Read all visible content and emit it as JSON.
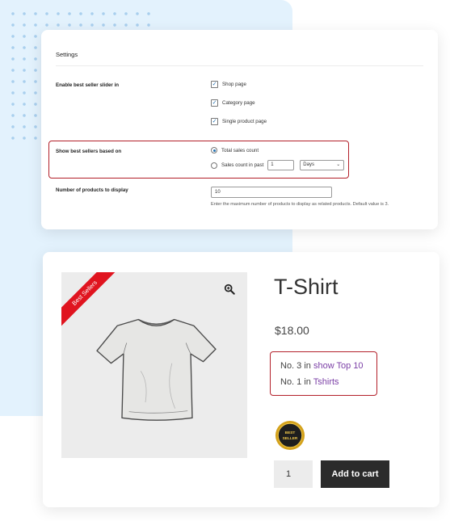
{
  "settings": {
    "title": "Settings",
    "enable_slider_label": "Enable best seller slider in",
    "slider_options": [
      {
        "label": "Shop page",
        "checked": true
      },
      {
        "label": "Category page",
        "checked": true
      },
      {
        "label": "Single product page",
        "checked": true
      }
    ],
    "based_on_label": "Show best sellers based on",
    "based_on_options": [
      {
        "label": "Total sales count",
        "selected": true
      },
      {
        "label": "Sales count in past",
        "selected": false
      }
    ],
    "past_value": "1",
    "past_unit": "Days",
    "num_products_label": "Number of products to display",
    "num_products_value": "10",
    "help_text": "Enter the maximum number of products to display as related products. Default value is 3."
  },
  "product": {
    "ribbon": "Best Sellers",
    "title": "T-Shirt",
    "price": "$18.00",
    "rank1_prefix": "No. 3",
    "rank1_in": "in",
    "rank1_link": "show Top 10",
    "rank2_prefix": "No. 1",
    "rank2_in": "in",
    "rank2_link": "Tshirts",
    "seal_line1": "BEST",
    "seal_line2": "SELLER",
    "quantity": "1",
    "add_to_cart": "Add to cart"
  },
  "colors": {
    "highlight_border": "#b3202a",
    "ribbon": "#e0141f",
    "link": "#7b3fa6",
    "button": "#2b2b2b",
    "panel_bg": "#e3f2fd"
  },
  "icons": [
    "checkbox-checked-icon",
    "radio-icon",
    "chevron-down-icon",
    "zoom-icon",
    "tshirt-image",
    "best-seller-seal-icon"
  ]
}
